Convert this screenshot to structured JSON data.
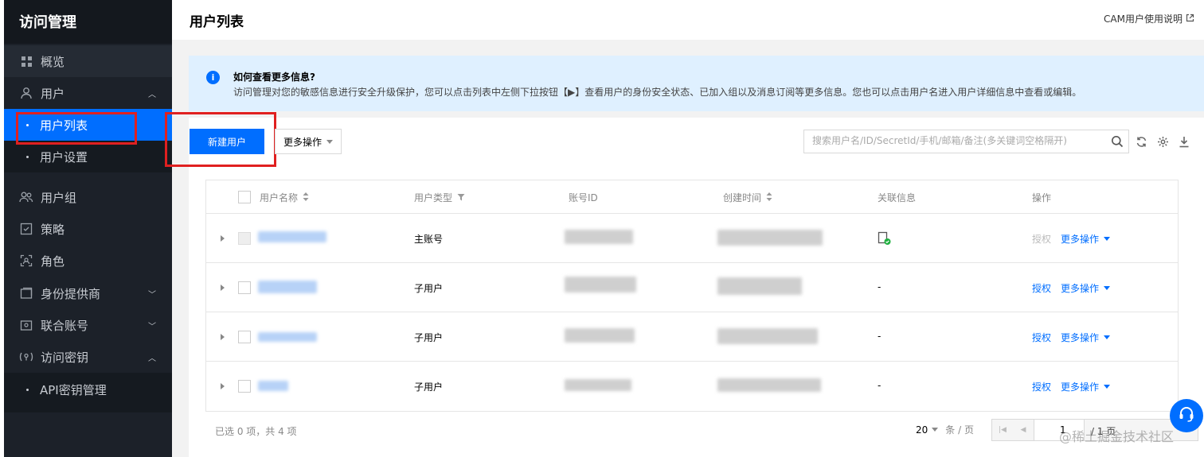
{
  "sidebar": {
    "title": "访问管理",
    "items": {
      "overview": "概览",
      "users": "用户",
      "user_list": "用户列表",
      "user_settings": "用户设置",
      "user_groups": "用户组",
      "policies": "策略",
      "roles": "角色",
      "identity_providers": "身份提供商",
      "federated_accounts": "联合账号",
      "access_keys": "访问密钥",
      "api_key_mgmt": "API密钥管理"
    }
  },
  "header": {
    "title": "用户列表",
    "help_link": "CAM用户使用说明"
  },
  "banner": {
    "title": "如何查看更多信息?",
    "text": "访问管理对您的敏感信息进行安全升级保护，您可以点击列表中左侧下拉按钮【▶】查看用户的身份安全状态、已加入组以及消息订阅等更多信息。您也可以点击用户名进入用户详细信息中查看或编辑。"
  },
  "toolbar": {
    "create_user": "新建用户",
    "more_actions": "更多操作",
    "search_placeholder": "搜索用户名/ID/SecretId/手机/邮箱/备注(多关键词空格隔开)"
  },
  "table": {
    "headers": {
      "username": "用户名称",
      "user_type": "用户类型",
      "account_id": "账号ID",
      "created_time": "创建时间",
      "linked_info": "关联信息",
      "actions": "操作"
    },
    "rows": [
      {
        "user_type": "主账号",
        "linked": "",
        "authorize": "授权",
        "more": "更多操作"
      },
      {
        "user_type": "子用户",
        "linked": "-",
        "authorize": "授权",
        "more": "更多操作"
      },
      {
        "user_type": "子用户",
        "linked": "-",
        "authorize": "授权",
        "more": "更多操作"
      },
      {
        "user_type": "子用户",
        "linked": "-",
        "authorize": "授权",
        "more": "更多操作"
      }
    ]
  },
  "footer": {
    "selection_summary": "已选 0 项，共 4 项",
    "page_size": "20",
    "page_size_unit": "条 / 页",
    "current_page": "1",
    "total_pages": "/ 1 页"
  },
  "watermark": "@稀土掘金技术社区",
  "colors": {
    "sidebar_bg": "#1c2129",
    "active_blue": "#006eff",
    "banner_bg": "#dff0ff",
    "highlight_red": "#e02020"
  }
}
